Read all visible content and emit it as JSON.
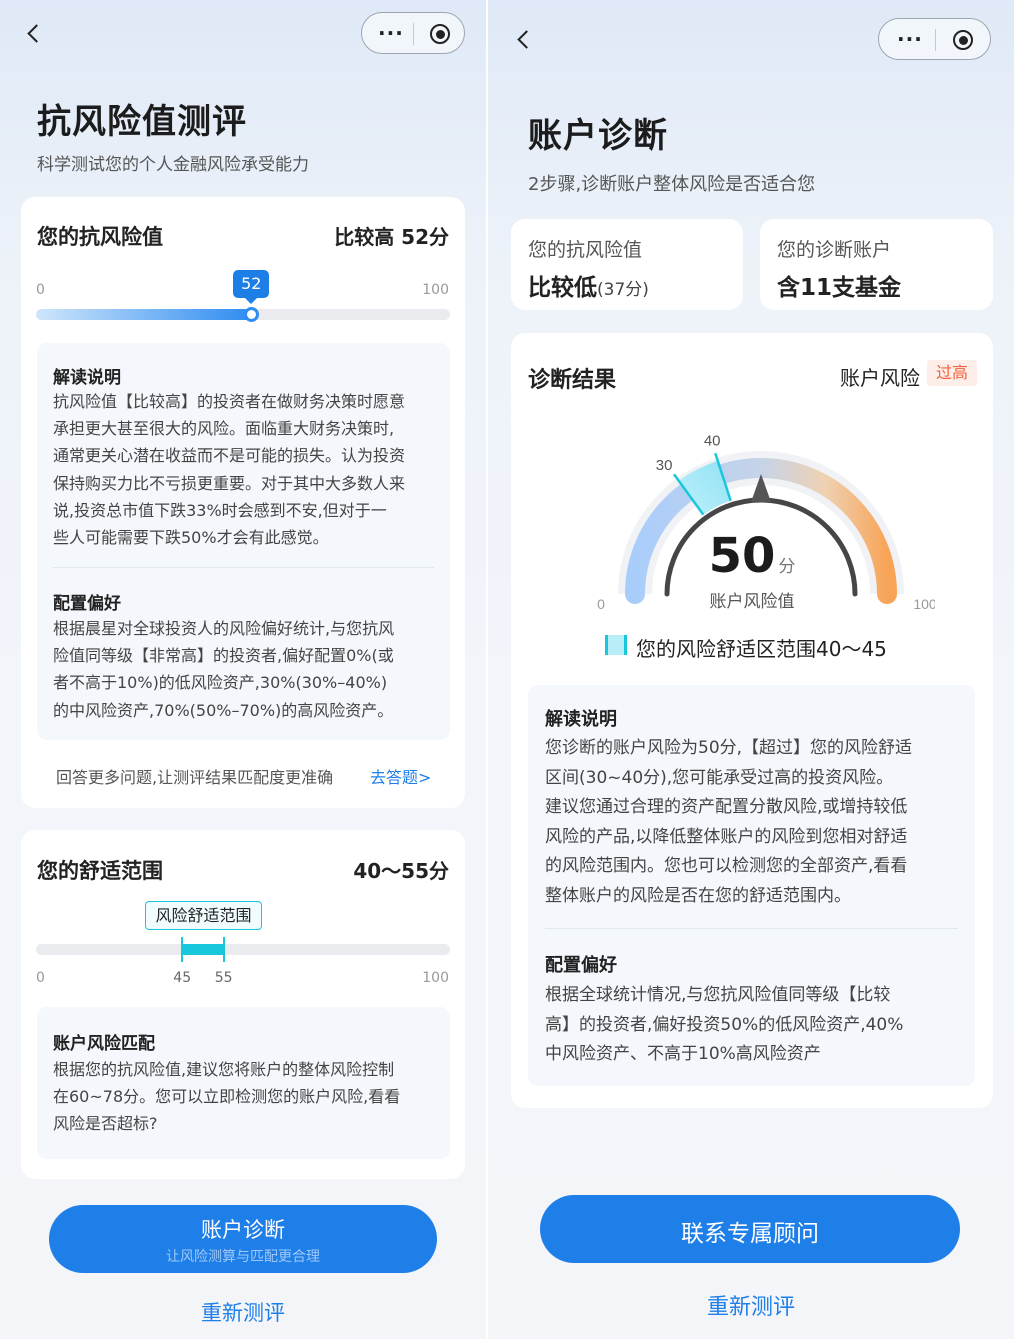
{
  "left": {
    "title": "抗风险值测评",
    "subtitle": "科学测试您的个人金融风险承受能力",
    "risk_card": {
      "title": "您的抗风险值",
      "summary": "比较高 52分",
      "score": 52,
      "min_label": "0",
      "max_label": "100",
      "bubble_label": "52",
      "info": {
        "title1": "解读说明",
        "lines1": [
          "抗风险值【比较高】的投资者在做财务决策时愿意",
          "承担更大甚至很大的风险。面临重大财务决策时,",
          "通常更关心潜在收益而不是可能的损失。认为投资",
          "保持购买力比不亏损更重要。对于其中大多数人来",
          "说,投资总市值下跌33%时会感到不安,但对于一",
          "些人可能需要下跌50%才会有此感觉。"
        ],
        "title2": "配置偏好",
        "lines2": [
          "根据晨星对全球投资人的风险偏好统计,与您抗风",
          "险值同等级【非常高】的投资者,偏好配置0%(或",
          "者不高于10%)的低风险资产,30%(30%–40%)",
          "的中风险资产,70%(50%–70%)的高风险资产。"
        ]
      },
      "more_text": "回答更多问题,让测评结果匹配度更准确",
      "more_link": "去答题>"
    },
    "comfort_card": {
      "title": "您的舒适范围",
      "summary": "40～55分",
      "tag": "风险舒适范围",
      "range_low": 45,
      "range_high": 55,
      "ticks": [
        "0",
        "45",
        "55",
        "100"
      ],
      "info_title": "账户风险匹配",
      "info_lines": [
        "根据您的抗风险值,建议您将账户的整体风险控制",
        "在60~78分。您可以立即检测您的账户风险,看看",
        "风险是否超标?"
      ]
    },
    "primary_button": {
      "label": "账户诊断",
      "sub": "让风险测算与匹配更合理"
    },
    "retest": "重新测评"
  },
  "right": {
    "title": "账户诊断",
    "subtitle": "2步骤,诊断账户整体风险是否适合您",
    "mini1": {
      "label": "您的抗风险值",
      "value": "比较低",
      "value_sub": "(37分)"
    },
    "mini2": {
      "label": "您的诊断账户",
      "value": "含11支基金"
    },
    "result_card": {
      "title": "诊断结果",
      "risk_label": "账户风险",
      "risk_badge": "过高",
      "gauge": {
        "value": "50",
        "unit": "分",
        "caption": "账户风险值",
        "pointer": 50,
        "comfort_low": 30,
        "comfort_high": 40,
        "min_label": "0",
        "max_label": "100",
        "label_30": "30",
        "label_40": "40"
      },
      "legend": "您的风险舒适区范围40～45",
      "info": {
        "title1": "解读说明",
        "lines1": [
          "您诊断的账户风险为50分,【超过】您的风险舒适",
          "区间(30~40分),您可能承受过高的投资风险。",
          "建议您通过合理的资产配置分散风险,或增持较低",
          "风险的产品,以降低整体账户的风险到您相对舒适",
          "的风险范围内。您也可以检测您的全部资产,看看",
          "整体账户的风险是否在您的舒适范围内。"
        ],
        "title2": "配置偏好",
        "lines2": [
          "根据全球统计情况,与您抗风险值同等级【比较",
          "高】的投资者,偏好投资50%的低风险资产,40%",
          "中风险资产、不高于10%高风险资产"
        ]
      }
    },
    "primary_button": {
      "label": "联系专属顾问"
    },
    "retest": "重新测评"
  },
  "colors": {
    "accent": "#1f7fe8",
    "comfort": "#19c7dc",
    "warning": "#f2603c",
    "gauge_start": "#a9cdfb",
    "gauge_end": "#f8a458"
  },
  "icons": {
    "back": "chevron-left-icon",
    "more": "more-dots-icon",
    "record": "record-icon"
  }
}
